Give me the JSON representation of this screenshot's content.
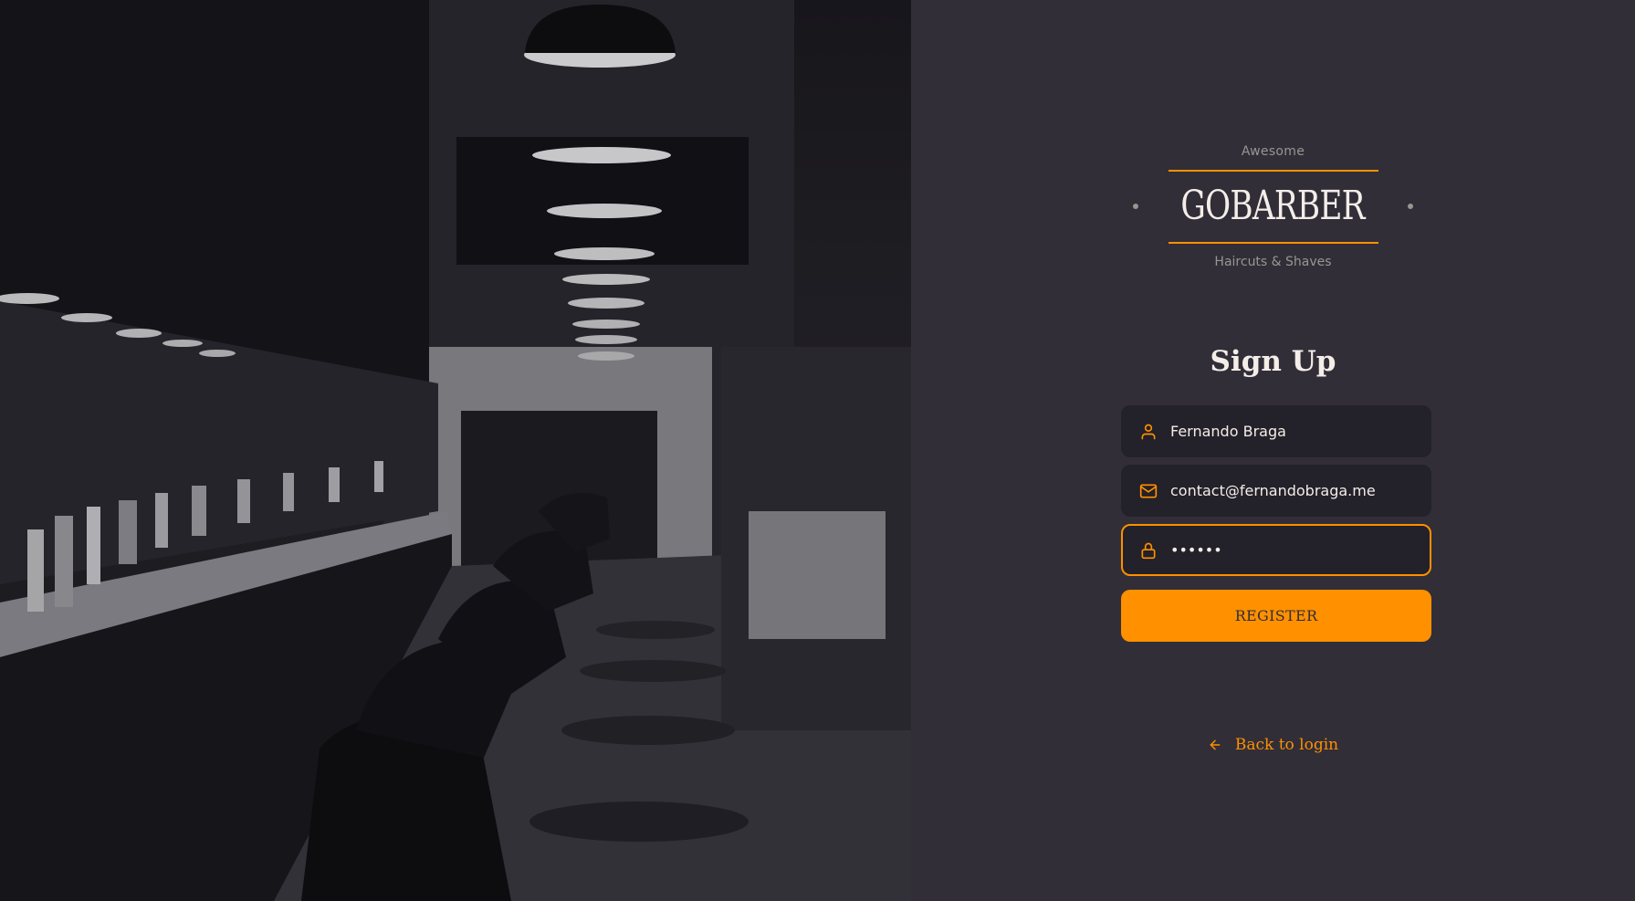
{
  "logo": {
    "tagline_top": "Awesome",
    "wordmark": "GOBARBER",
    "tagline_bottom": "Haircuts & Shaves"
  },
  "form": {
    "title": "Sign Up",
    "name_value": "Fernando Braga",
    "email_value": "contact@fernandobraga.me",
    "password_value": "••••••",
    "submit_label": "REGISTER"
  },
  "footer": {
    "back_label": "Back to login"
  },
  "icons": {
    "name": "user-icon",
    "email": "mail-icon",
    "password": "lock-icon",
    "back": "arrow-left-icon"
  },
  "colors": {
    "accent": "#ff9000",
    "background": "#312e38",
    "input_bg": "#232129",
    "text": "#f4ede8",
    "muted": "#999591"
  }
}
